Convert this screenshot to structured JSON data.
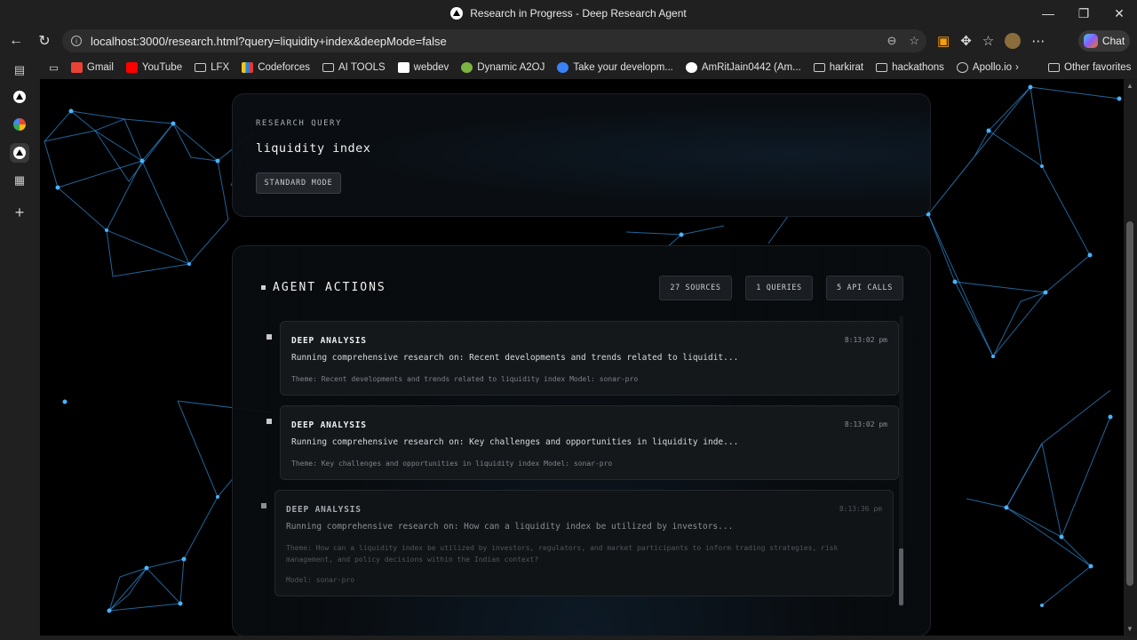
{
  "window": {
    "title": "Research in Progress - Deep Research Agent",
    "controls": {
      "minimize": "—",
      "restore": "❐",
      "close": "✕"
    }
  },
  "browser": {
    "url": "localhost:3000/research.html?query=liquidity+index&deepMode=false",
    "chat_label": "Chat",
    "bookmarks": [
      {
        "label": "Gmail",
        "icon": "gmail-icon",
        "color": "#ea4335"
      },
      {
        "label": "YouTube",
        "icon": "youtube-icon",
        "color": "#ff0000"
      },
      {
        "label": "LFX",
        "icon": "folder-icon"
      },
      {
        "label": "Codeforces",
        "icon": "codeforces-icon",
        "color": "#f5c518"
      },
      {
        "label": "AI TOOLS",
        "icon": "folder-icon"
      },
      {
        "label": "webdev",
        "icon": "w3-icon",
        "color": "#ffffff"
      },
      {
        "label": "Dynamic A2OJ",
        "icon": "a2oj-icon",
        "color": "#7cb342"
      },
      {
        "label": "Take your developm...",
        "icon": "profile-icon",
        "color": "#3b82f6"
      },
      {
        "label": "AmRitJain0442 (Am...",
        "icon": "github-icon",
        "color": "#ffffff"
      },
      {
        "label": "harkirat",
        "icon": "folder-icon"
      },
      {
        "label": "hackathons",
        "icon": "folder-icon"
      },
      {
        "label": "Apollo.io",
        "icon": "globe-icon"
      }
    ],
    "other_favorites": "Other favorites"
  },
  "query_card": {
    "label": "RESEARCH QUERY",
    "query": "liquidity index",
    "mode": "STANDARD MODE"
  },
  "actions": {
    "title": "AGENT ACTIONS",
    "stats": {
      "sources": "27 SOURCES",
      "queries": "1 QUERIES",
      "api_calls": "5 API CALLS"
    },
    "items": [
      {
        "type": "DEEP ANALYSIS",
        "time": "8:13:02 pm",
        "description": "Running comprehensive research on: Recent developments and trends related to liquidit...",
        "meta": "Theme: Recent developments and trends related to liquidity index  Model: sonar-pro"
      },
      {
        "type": "DEEP ANALYSIS",
        "time": "8:13:02 pm",
        "description": "Running comprehensive research on: Key challenges and opportunities in liquidity inde...",
        "meta": "Theme: Key challenges and opportunities in liquidity index  Model: sonar-pro"
      },
      {
        "type": "DEEP ANALYSIS",
        "time": "8:13:36 pm",
        "description": "Running comprehensive research on: How can a liquidity index be utilized by investors...",
        "meta_line1": "Theme: How can a liquidity index be utilized by investors, regulators, and market participants to inform trading strategies, risk",
        "meta_line2": "management, and policy decisions within the Indian context?",
        "meta_line3": "Model: sonar-pro"
      }
    ]
  }
}
